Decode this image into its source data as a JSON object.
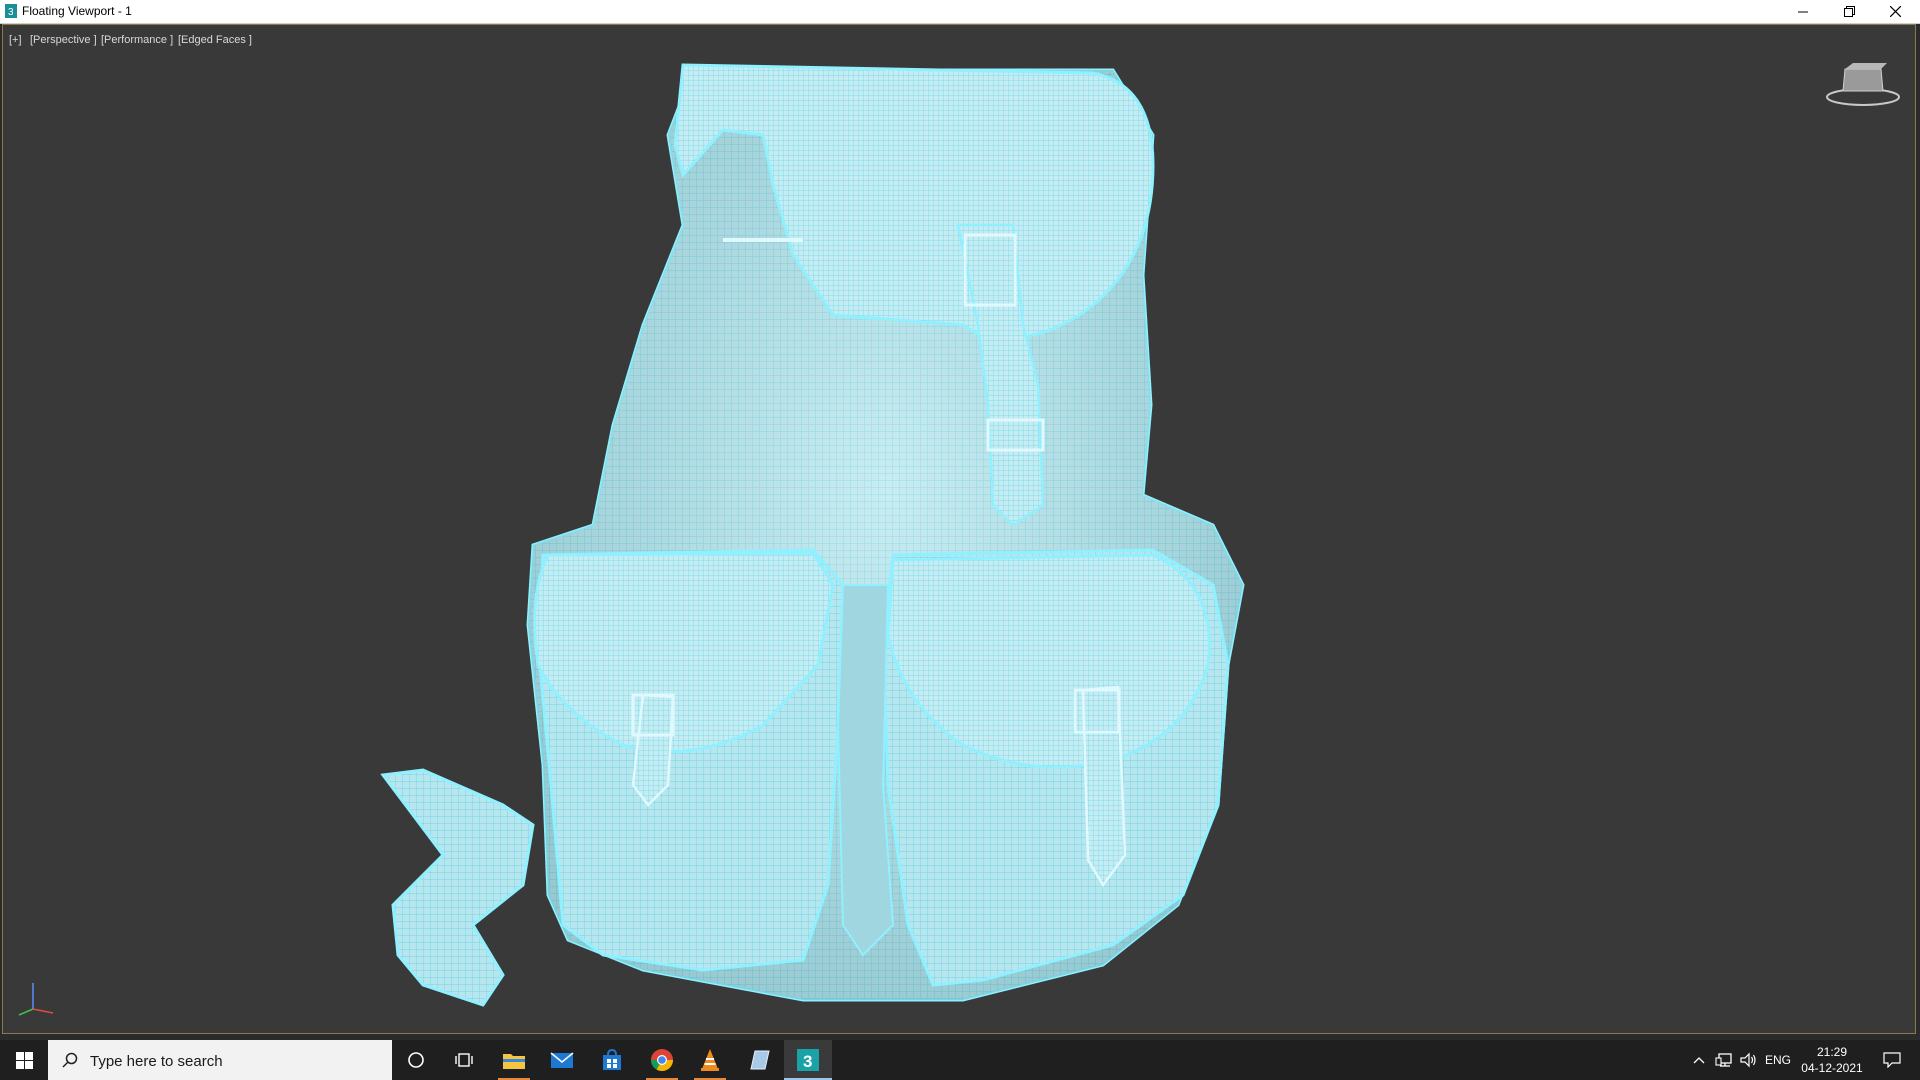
{
  "window": {
    "title": "Floating Viewport - 1",
    "controls": {
      "minimize_icon": "minimize-icon",
      "restore_icon": "restore-icon",
      "close_icon": "close-icon"
    }
  },
  "viewport": {
    "labels": {
      "plus": "[+]",
      "view": "[Perspective ]",
      "performance": "[Performance ]",
      "shading": "[Edged Faces ]"
    },
    "background_color": "#393939",
    "model_wire_color": "#7fe3f0",
    "model_fill_color": "#cfeef4",
    "model": "backpack wireframe mesh"
  },
  "taskbar": {
    "search_placeholder": "Type here to search",
    "pinned": [
      {
        "name": "cortana-icon"
      },
      {
        "name": "task-view-icon"
      },
      {
        "name": "file-explorer-icon"
      },
      {
        "name": "mail-icon"
      },
      {
        "name": "store-icon"
      },
      {
        "name": "chrome-icon"
      },
      {
        "name": "vlc-icon"
      },
      {
        "name": "app-icon"
      },
      {
        "name": "3ds-max-icon",
        "active": true
      }
    ],
    "tray": {
      "language": "ENG",
      "time": "21:29",
      "date": "04-12-2021"
    }
  }
}
